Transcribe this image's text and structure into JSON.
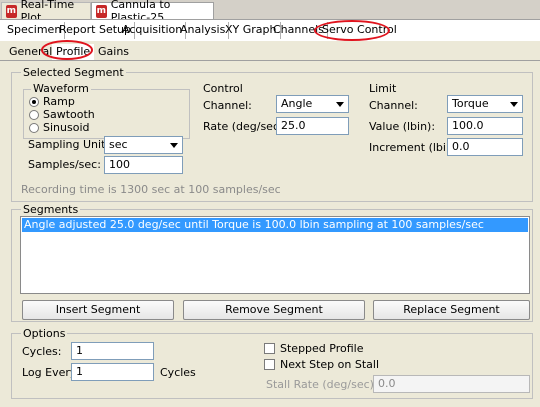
{
  "window_tabs": [
    {
      "label": "Real-Time Plot",
      "icon": "app-icon",
      "active": false
    },
    {
      "label": "Cannula to Plastic-25",
      "icon": "app-icon",
      "active": true
    }
  ],
  "main_tabs": [
    "Specimen",
    "Report Setup",
    "Acquisition",
    "Analysis",
    "XY Graph",
    "Channels",
    "Servo Control"
  ],
  "servo_tabs": [
    "General",
    "Profile",
    "Gains"
  ],
  "selected_segment": {
    "title": "Selected Segment",
    "waveform": {
      "title": "Waveform",
      "options": [
        "Ramp",
        "Sawtooth",
        "Sinusoid"
      ],
      "selected": "Ramp"
    },
    "sampling_units_label": "Sampling Units:",
    "sampling_units_value": "sec",
    "samples_label": "Samples/sec:",
    "samples_value": "100",
    "control": {
      "title": "Control",
      "channel_label": "Channel:",
      "channel_value": "Angle",
      "rate_label": "Rate (deg/sec):",
      "rate_value": "25.0"
    },
    "limit": {
      "title": "Limit",
      "channel_label": "Channel:",
      "channel_value": "Torque",
      "value_label": "Value (lbin):",
      "value_value": "100.0",
      "increment_label": "Increment (lbin):",
      "increment_value": "0.0"
    },
    "recording_text": "Recording time is 1300 sec at 100 samples/sec"
  },
  "segments": {
    "title": "Segments",
    "items": [
      "Angle adjusted 25.0 deg/sec until Torque is 100.0 lbin sampling at 100 samples/sec"
    ],
    "buttons": {
      "insert": "Insert Segment",
      "remove": "Remove Segment",
      "replace": "Replace Segment"
    }
  },
  "options": {
    "title": "Options",
    "cycles_label": "Cycles:",
    "cycles_value": "1",
    "log_every_label": "Log Every:",
    "log_every_value": "1",
    "log_every_unit": "Cycles",
    "stepped_profile_label": "Stepped Profile",
    "next_step_label": "Next Step on Stall",
    "stall_rate_label": "Stall Rate (deg/sec):",
    "stall_rate_value": "0.0"
  },
  "colors": {
    "highlight": "#3399ff",
    "annotation": "#e0141e"
  }
}
